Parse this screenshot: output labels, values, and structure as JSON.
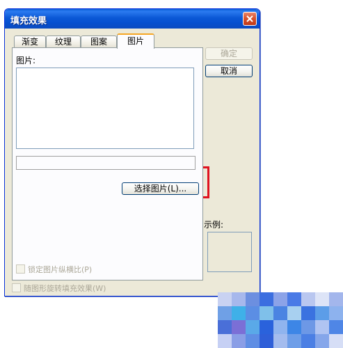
{
  "dialog": {
    "title": "填充效果",
    "tabs": [
      {
        "label": "渐变",
        "active": false
      },
      {
        "label": "纹理",
        "active": false
      },
      {
        "label": "图案",
        "active": false
      },
      {
        "label": "图片",
        "active": true
      }
    ],
    "picture_label": "图片:",
    "select_picture_button": "选择图片(L)...",
    "ok_button": "确定",
    "cancel_button": "取消",
    "sample_label": "示例:",
    "lock_aspect_checkbox": "锁定图片纵横比(P)",
    "rotate_with_shape_checkbox": "随图形旋转填充效果(W)"
  },
  "colors": {
    "titlebar": "#0b58d6",
    "dialog_bg": "#ece9d8",
    "highlight": "#e0121f",
    "close_button": "#d9542e"
  },
  "icons": {
    "close": "close-x-icon"
  },
  "mosaic_colors": [
    "#c9d2f2",
    "#a7b8ec",
    "#6c8fe0",
    "#3b6ee0",
    "#8ca3e8",
    "#4a7ae6",
    "#b9c7f0",
    "#dde4f7",
    "#a3b6ec",
    "#6fa0e6",
    "#3fb0e8",
    "#5b8ee4",
    "#7fc0ea",
    "#4a84e2",
    "#a8d0f0",
    "#3a72e0",
    "#5c9de8",
    "#8db2ee",
    "#4a6fd8",
    "#7b6fd6",
    "#5aa9e8",
    "#2a62dc",
    "#90b4ee",
    "#3d86e6",
    "#6d98e6",
    "#b0c4f2",
    "#4f86e6",
    "#c6d0f4",
    "#8a9ee6",
    "#5f8ee4",
    "#2f5fd8",
    "#a4bcee",
    "#6e9ee8",
    "#4b7fe4",
    "#85a6ea",
    "#d6def6"
  ]
}
